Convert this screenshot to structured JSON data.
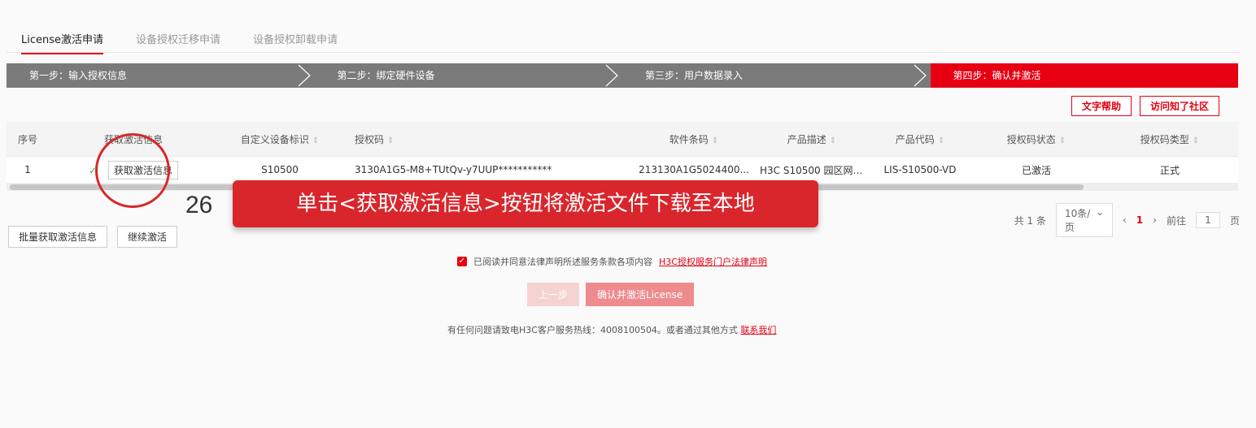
{
  "tabs": [
    "License激活申请",
    "设备授权迁移申请",
    "设备授权卸载申请"
  ],
  "steps": [
    "第一步：输入授权信息",
    "第二步：绑定硬件设备",
    "第三步：用户数据录入",
    "第四步：确认并激活"
  ],
  "help": {
    "text_help": "文字帮助",
    "community": "访问知了社区"
  },
  "table": {
    "headers": [
      "序号",
      "获取激活信息",
      "自定义设备标识",
      "授权码",
      "软件条码",
      "产品描述",
      "产品代码",
      "授权码状态",
      "授权码类型"
    ],
    "row": {
      "index": "1",
      "check": "✓",
      "fetch_button": "获取激活信息",
      "device_id": "S10500",
      "license_code": "3130A1G5-M8+TUtQv-y7UUP***********",
      "barcode": "213130A1G5024400...",
      "description": "H3C S10500 园区网功能...",
      "product_code": "LIS-S10500-VD",
      "status": "已激活",
      "type": "正式"
    }
  },
  "annotation": {
    "number": "26",
    "text": "单击<获取激活信息>按钮将激活文件下载至本地"
  },
  "pager": {
    "total": "共 1 条",
    "page_size": "10条/页",
    "current": "1",
    "goto_label": "前往",
    "goto_value": "1",
    "page_suffix": "页"
  },
  "batch": {
    "fetch_all": "批量获取激活信息",
    "continue": "继续激活"
  },
  "agree": {
    "text": "已阅读并同意法律声明所述服务条款各项内容",
    "link": "H3C授权服务门户法律声明"
  },
  "actions": {
    "prev": "上一步",
    "confirm": "确认并激活License"
  },
  "footer": {
    "text": "有任何问题请致电H3C客户服务热线：4008100504。或者通过其他方式",
    "link": "联系我们"
  },
  "colors": {
    "accent": "#e60012",
    "step_inactive": "#7a7a7a",
    "callout": "#d9262c"
  }
}
